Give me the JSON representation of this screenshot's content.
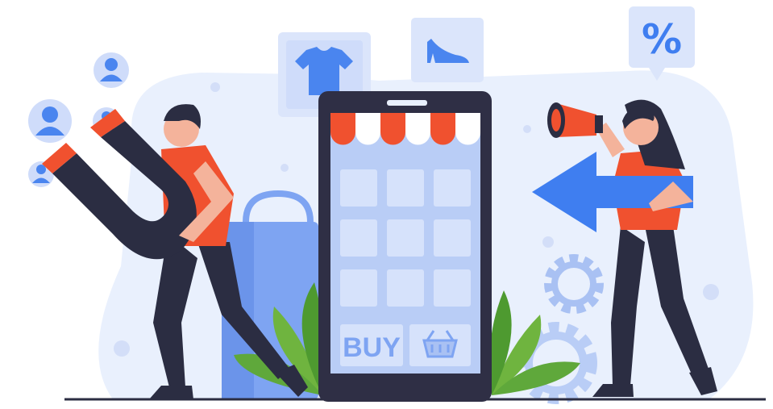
{
  "illustration": {
    "theme": "online-shopping-marketing",
    "phone": {
      "buy_label": "BUY",
      "cart_icon": "shopping-basket-icon"
    },
    "badges": {
      "discount_symbol": "%",
      "shirt_icon": "t-shirt-icon",
      "shoe_icon": "high-heel-icon"
    },
    "people": {
      "left": "man-with-magnet",
      "right": "woman-with-megaphone"
    },
    "colors": {
      "background_blob": "#e9f0fd",
      "phone_frame": "#2f2f45",
      "phone_screen": "#b9cdf6",
      "accent_blue": "#3f7ef0",
      "accent_orange": "#f0512f",
      "dark_navy": "#2b2d42",
      "leaf_green": "#5fa83b"
    }
  }
}
